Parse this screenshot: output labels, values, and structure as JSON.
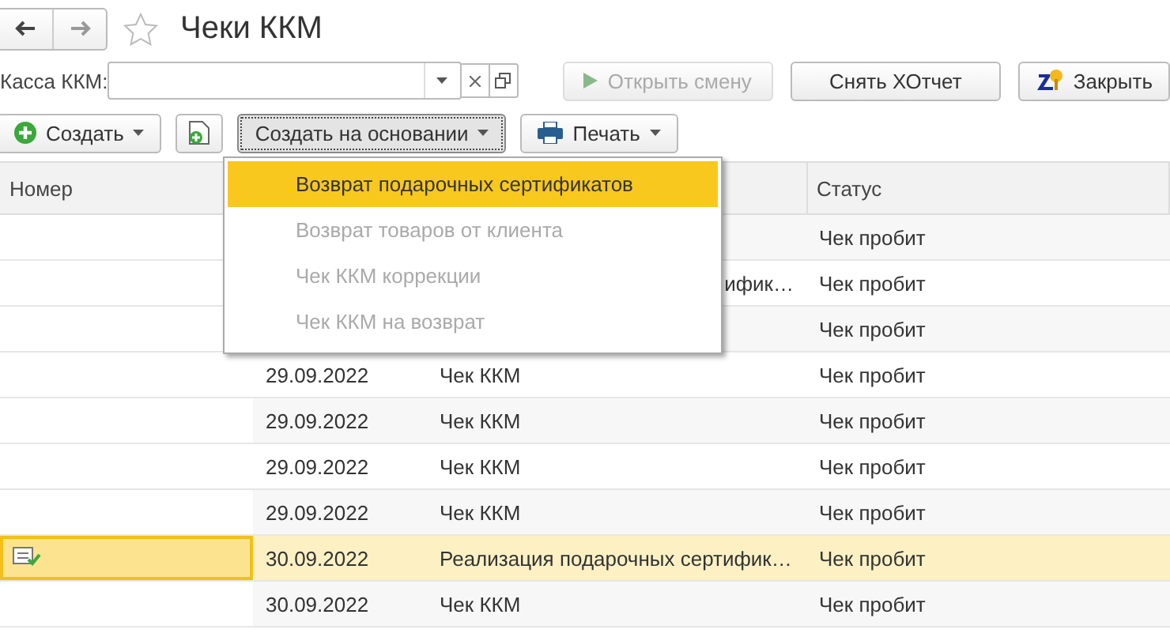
{
  "window": {
    "title": "Чеки ККМ",
    "favorite": false
  },
  "filter": {
    "label": "Касса ККМ:"
  },
  "actions": [
    {
      "label": "Открыть смену",
      "disabled": true,
      "kind": "play"
    },
    {
      "label": "Снять ХОтчет",
      "disabled": false,
      "kind": "plain"
    },
    {
      "label": "Закрыть",
      "disabled": false,
      "kind": "report"
    }
  ],
  "toolbar": [
    {
      "label": "Создать",
      "kind": "create",
      "pressed": false
    },
    {
      "kind": "copy",
      "pressed": false
    },
    {
      "label": "Создать на основании",
      "kind": "menu",
      "pressed": true
    },
    {
      "label": "Печать",
      "kind": "print",
      "pressed": false
    }
  ],
  "menu": [
    {
      "label": "Возврат подарочных сертификатов",
      "selected": true,
      "disabled": false
    },
    {
      "label": "Возврат товаров от клиента",
      "selected": false,
      "disabled": true
    },
    {
      "label": "Чек ККМ коррекции",
      "selected": false,
      "disabled": true
    },
    {
      "label": "Чек ККМ на возврат",
      "selected": false,
      "disabled": true
    }
  ],
  "table": {
    "columns": {
      "column_1": "Номер",
      "column_4": "Статус"
    },
    "rows": [
      {
        "status": "Чек пробит",
        "selected": false
      },
      {
        "type": "ифик…",
        "status": "Чек пробит",
        "selected": false,
        "covered": true
      },
      {
        "status": "Чек пробит",
        "selected": false
      },
      {
        "date": "29.09.2022",
        "type": "Чек ККМ",
        "status": "Чек пробит",
        "selected": false,
        "covered": false
      },
      {
        "date": "29.09.2022",
        "type": "Чек ККМ",
        "status": "Чек пробит",
        "selected": false,
        "covered": false
      },
      {
        "date": "29.09.2022",
        "type": "Чек ККМ",
        "status": "Чек пробит",
        "selected": false,
        "covered": false
      },
      {
        "date": "29.09.2022",
        "type": "Чек ККМ",
        "status": "Чек пробит",
        "selected": false,
        "covered": false
      },
      {
        "date": "30.09.2022",
        "type": "Реализация подарочных сертифик…",
        "status": "Чек пробит",
        "selected": true,
        "covered": false
      },
      {
        "date": "30.09.2022",
        "type": "Чек ККМ",
        "status": "Чек пробит",
        "selected": false,
        "covered": false
      }
    ]
  }
}
